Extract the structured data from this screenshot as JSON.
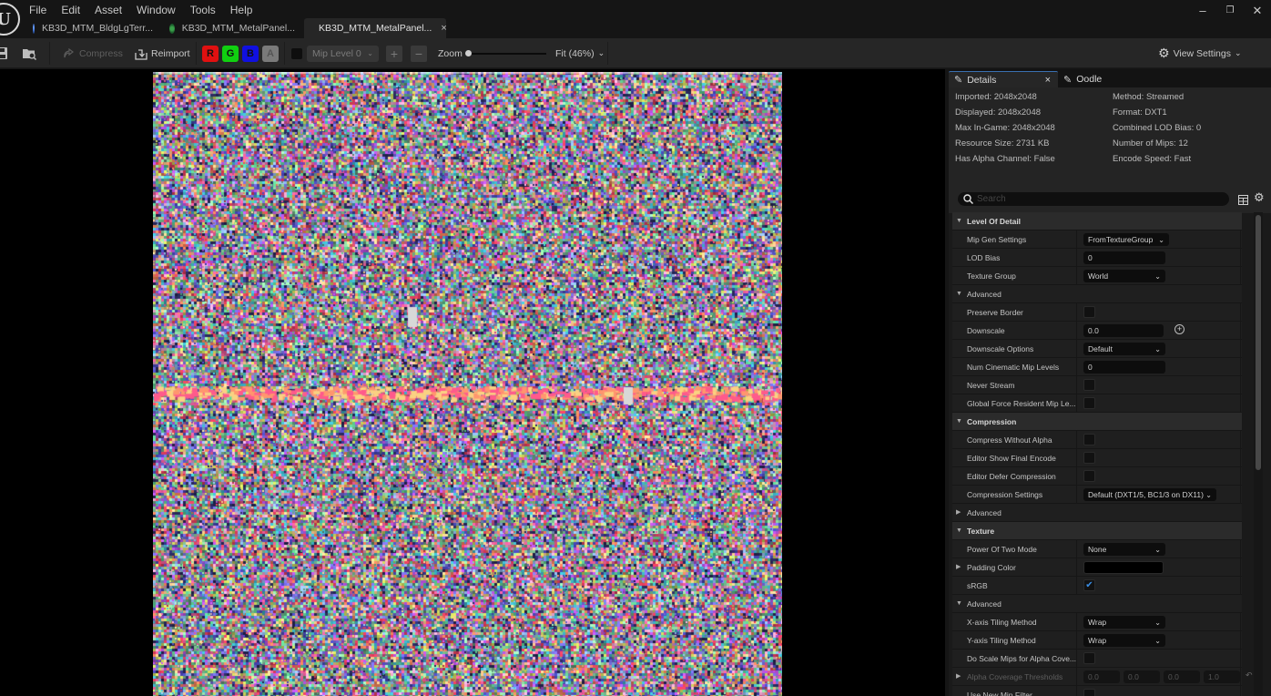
{
  "menu": [
    "File",
    "Edit",
    "Asset",
    "Window",
    "Tools",
    "Help"
  ],
  "window_controls": {
    "minimize": "–",
    "restore": "❐",
    "close": "✕"
  },
  "tabs": [
    {
      "label": "KB3D_MTM_BldgLgTerr...",
      "icon": "material-sphere-icon",
      "icon_color": "#3a6fd0"
    },
    {
      "label": "KB3D_MTM_MetalPanel...",
      "icon": "material-instance-icon",
      "icon_color": "#2a8a3a"
    },
    {
      "label": "KB3D_MTM_MetalPanel...",
      "icon": "texture-icon",
      "icon_color": "#c0303a",
      "active": true,
      "close": "×"
    }
  ],
  "toolbar": {
    "compress_label": "Compress",
    "reimport_label": "Reimport",
    "channels": [
      {
        "label": "R",
        "color": "#e01010"
      },
      {
        "label": "G",
        "color": "#10d010"
      },
      {
        "label": "B",
        "color": "#1010e0"
      },
      {
        "label": "A",
        "color": "#7a7a7a"
      }
    ],
    "mip_level": "Mip Level 0",
    "zoom_label": "Zoom",
    "zoom_value": "Fit (46%)",
    "zoom_slider_fraction": 0.0,
    "view_settings_label": "View Settings"
  },
  "details": {
    "tab_label": "Details",
    "tab_close": "×",
    "oodle_tab_label": "Oodle",
    "info_left": [
      "Imported: 2048x2048",
      "Displayed: 2048x2048",
      "Max In-Game: 2048x2048",
      "Resource Size: 2731 KB",
      "Has Alpha Channel: False"
    ],
    "info_right": [
      "Method: Streamed",
      "Format: DXT1",
      "Combined LOD Bias: 0",
      "Number of Mips: 12",
      "Encode Speed: Fast"
    ],
    "search_placeholder": "Search",
    "rows": [
      {
        "type": "cat",
        "label": "Level Of Detail",
        "arrow": "▼"
      },
      {
        "type": "dropdown",
        "label": "Mip Gen Settings",
        "value": "FromTextureGroup"
      },
      {
        "type": "input",
        "label": "LOD Bias",
        "value": "0"
      },
      {
        "type": "dropdown",
        "label": "Texture Group",
        "value": "World"
      },
      {
        "type": "sub",
        "label": "Advanced",
        "arrow": "▼"
      },
      {
        "type": "check",
        "label": "Preserve Border",
        "checked": false
      },
      {
        "type": "input",
        "label": "Downscale",
        "value": "0.0",
        "add": true
      },
      {
        "type": "dropdown",
        "label": "Downscale Options",
        "value": "Default"
      },
      {
        "type": "input",
        "label": "Num Cinematic Mip Levels",
        "value": "0"
      },
      {
        "type": "check",
        "label": "Never Stream",
        "checked": false
      },
      {
        "type": "check",
        "label": "Global Force Resident Mip Le...",
        "checked": false
      },
      {
        "type": "cat",
        "label": "Compression",
        "arrow": "▼"
      },
      {
        "type": "check",
        "label": "Compress Without Alpha",
        "checked": false
      },
      {
        "type": "check",
        "label": "Editor Show Final Encode",
        "checked": false
      },
      {
        "type": "check",
        "label": "Editor Defer Compression",
        "checked": false
      },
      {
        "type": "dropdown-wide",
        "label": "Compression Settings",
        "value": "Default (DXT1/5, BC1/3 on DX11)"
      },
      {
        "type": "sub",
        "label": "Advanced",
        "arrow": "▶"
      },
      {
        "type": "cat",
        "label": "Texture",
        "arrow": "▼"
      },
      {
        "type": "dropdown",
        "label": "Power Of Two Mode",
        "value": "None"
      },
      {
        "type": "color",
        "label": "Padding Color",
        "arrow": "▶",
        "value": "#000000"
      },
      {
        "type": "check",
        "label": "sRGB",
        "checked": true
      },
      {
        "type": "sub",
        "label": "Advanced",
        "arrow": "▼"
      },
      {
        "type": "dropdown",
        "label": "X-axis Tiling Method",
        "value": "Wrap"
      },
      {
        "type": "dropdown",
        "label": "Y-axis Tiling Method",
        "value": "Wrap"
      },
      {
        "type": "check",
        "label": "Do Scale Mips for Alpha Cove...",
        "checked": false
      },
      {
        "type": "vector",
        "label": "Alpha Coverage Thresholds",
        "arrow": "▶",
        "values": [
          "0.0",
          "0.0",
          "0.0",
          "1.0"
        ],
        "dim": true
      },
      {
        "type": "check",
        "label": "Use New Mip Filter",
        "checked": false
      }
    ]
  }
}
